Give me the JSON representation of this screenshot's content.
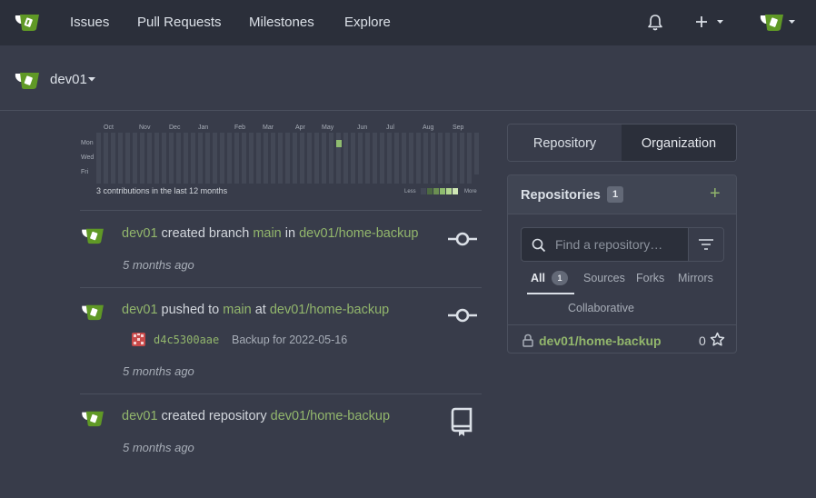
{
  "nav": {
    "items": [
      "Issues",
      "Pull Requests",
      "Milestones",
      "Explore"
    ],
    "icons": [
      "gitea-logo-icon",
      "bell-icon",
      "plus-icon",
      "user-avatar-icon"
    ]
  },
  "context": {
    "name": "dev01"
  },
  "heatmap": {
    "months": [
      "Oct",
      "Nov",
      "Dec",
      "Jan",
      "Feb",
      "Mar",
      "Apr",
      "May",
      "Jun",
      "Jul",
      "Aug",
      "Sep"
    ],
    "days": [
      "Mon",
      "Wed",
      "Fri"
    ],
    "summary": "3 contributions in the last 12 months",
    "less": "Less",
    "more": "More",
    "colors": {
      "empty": "#434856",
      "active": "#8fbc6f"
    }
  },
  "feed": [
    {
      "user": "dev01",
      "action": " created branch ",
      "ref": "main",
      "prep": " in ",
      "repo": "dev01/home-backup",
      "time": "5 months ago",
      "icon": "git-commit-icon"
    },
    {
      "user": "dev01",
      "action": " pushed to ",
      "ref": "main",
      "prep": " at ",
      "repo": "dev01/home-backup",
      "time": "5 months ago",
      "icon": "git-commit-icon",
      "commit": {
        "sha": "d4c5300aae",
        "message": "Backup for 2022-05-16"
      }
    },
    {
      "user": "dev01",
      "action": " created repository ",
      "repo": "dev01/home-backup",
      "time": "5 months ago",
      "icon": "repo-icon"
    }
  ],
  "switcher": {
    "left": "Repository",
    "right": "Organization"
  },
  "repos_panel": {
    "title": "Repositories",
    "count": "1",
    "search_placeholder": "Find a repository…",
    "tabs": [
      "All",
      "Sources",
      "Forks",
      "Mirrors",
      "Collaborative"
    ],
    "all_count": "1",
    "items": [
      {
        "name": "dev01/home-backup",
        "stars": "0"
      }
    ]
  },
  "accent": "#92b66c"
}
